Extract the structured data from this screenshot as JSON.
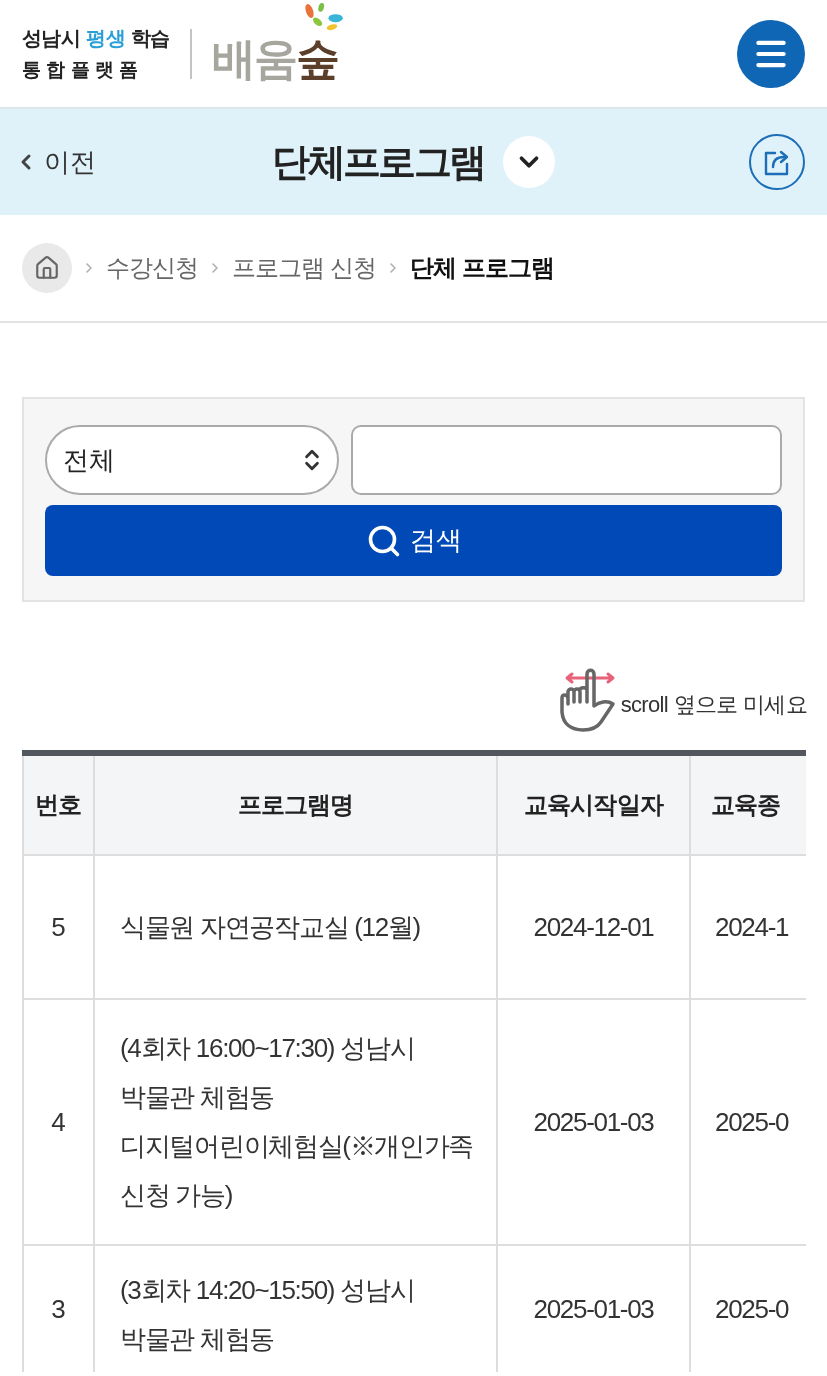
{
  "header": {
    "logo": {
      "line_1": [
        {
          "text": "성남시",
          "color": "#222222"
        },
        {
          "text": "평생",
          "color": "#2a9fd6"
        },
        {
          "text": "학습",
          "color": "#222222"
        }
      ],
      "line_2": "통 합 플 랫 폼",
      "brand": [
        {
          "text": "배움",
          "color": "#a6a69e"
        },
        {
          "text": "숲",
          "color": "#5b3f2a"
        }
      ]
    }
  },
  "title_bar": {
    "back": "이전",
    "title": "단체프로그램"
  },
  "breadcrumb": [
    {
      "label": "수강신청",
      "current": false
    },
    {
      "label": "프로그램 신청",
      "current": false
    },
    {
      "label": "단체 프로그램",
      "current": true
    }
  ],
  "search": {
    "select": {
      "value": "전체"
    },
    "button": "검색"
  },
  "scroll_hint": "scroll 옆으로 미세요",
  "table": {
    "columns": [
      "번호",
      "프로그램명",
      "교육시작일자",
      "교육종"
    ],
    "rows": [
      {
        "number": "5",
        "program": [
          "식물원 자연공작교실 (12월)"
        ],
        "start_date": "2024-12-01",
        "column_4": "2024-1"
      },
      {
        "number": "4",
        "program": [
          "(4회차 16:00~17:30) 성남시",
          "박물관 체험동",
          "디지털어린이체험실(※개인가족",
          "신청 가능)"
        ],
        "start_date": "2025-01-03",
        "column_4": "2025-0"
      },
      {
        "number": "3",
        "program": [
          "(3회차 14:20~15:50) 성남시",
          "박물관 체험동"
        ],
        "start_date": "2025-01-03",
        "column_4": "2025-0"
      }
    ]
  }
}
